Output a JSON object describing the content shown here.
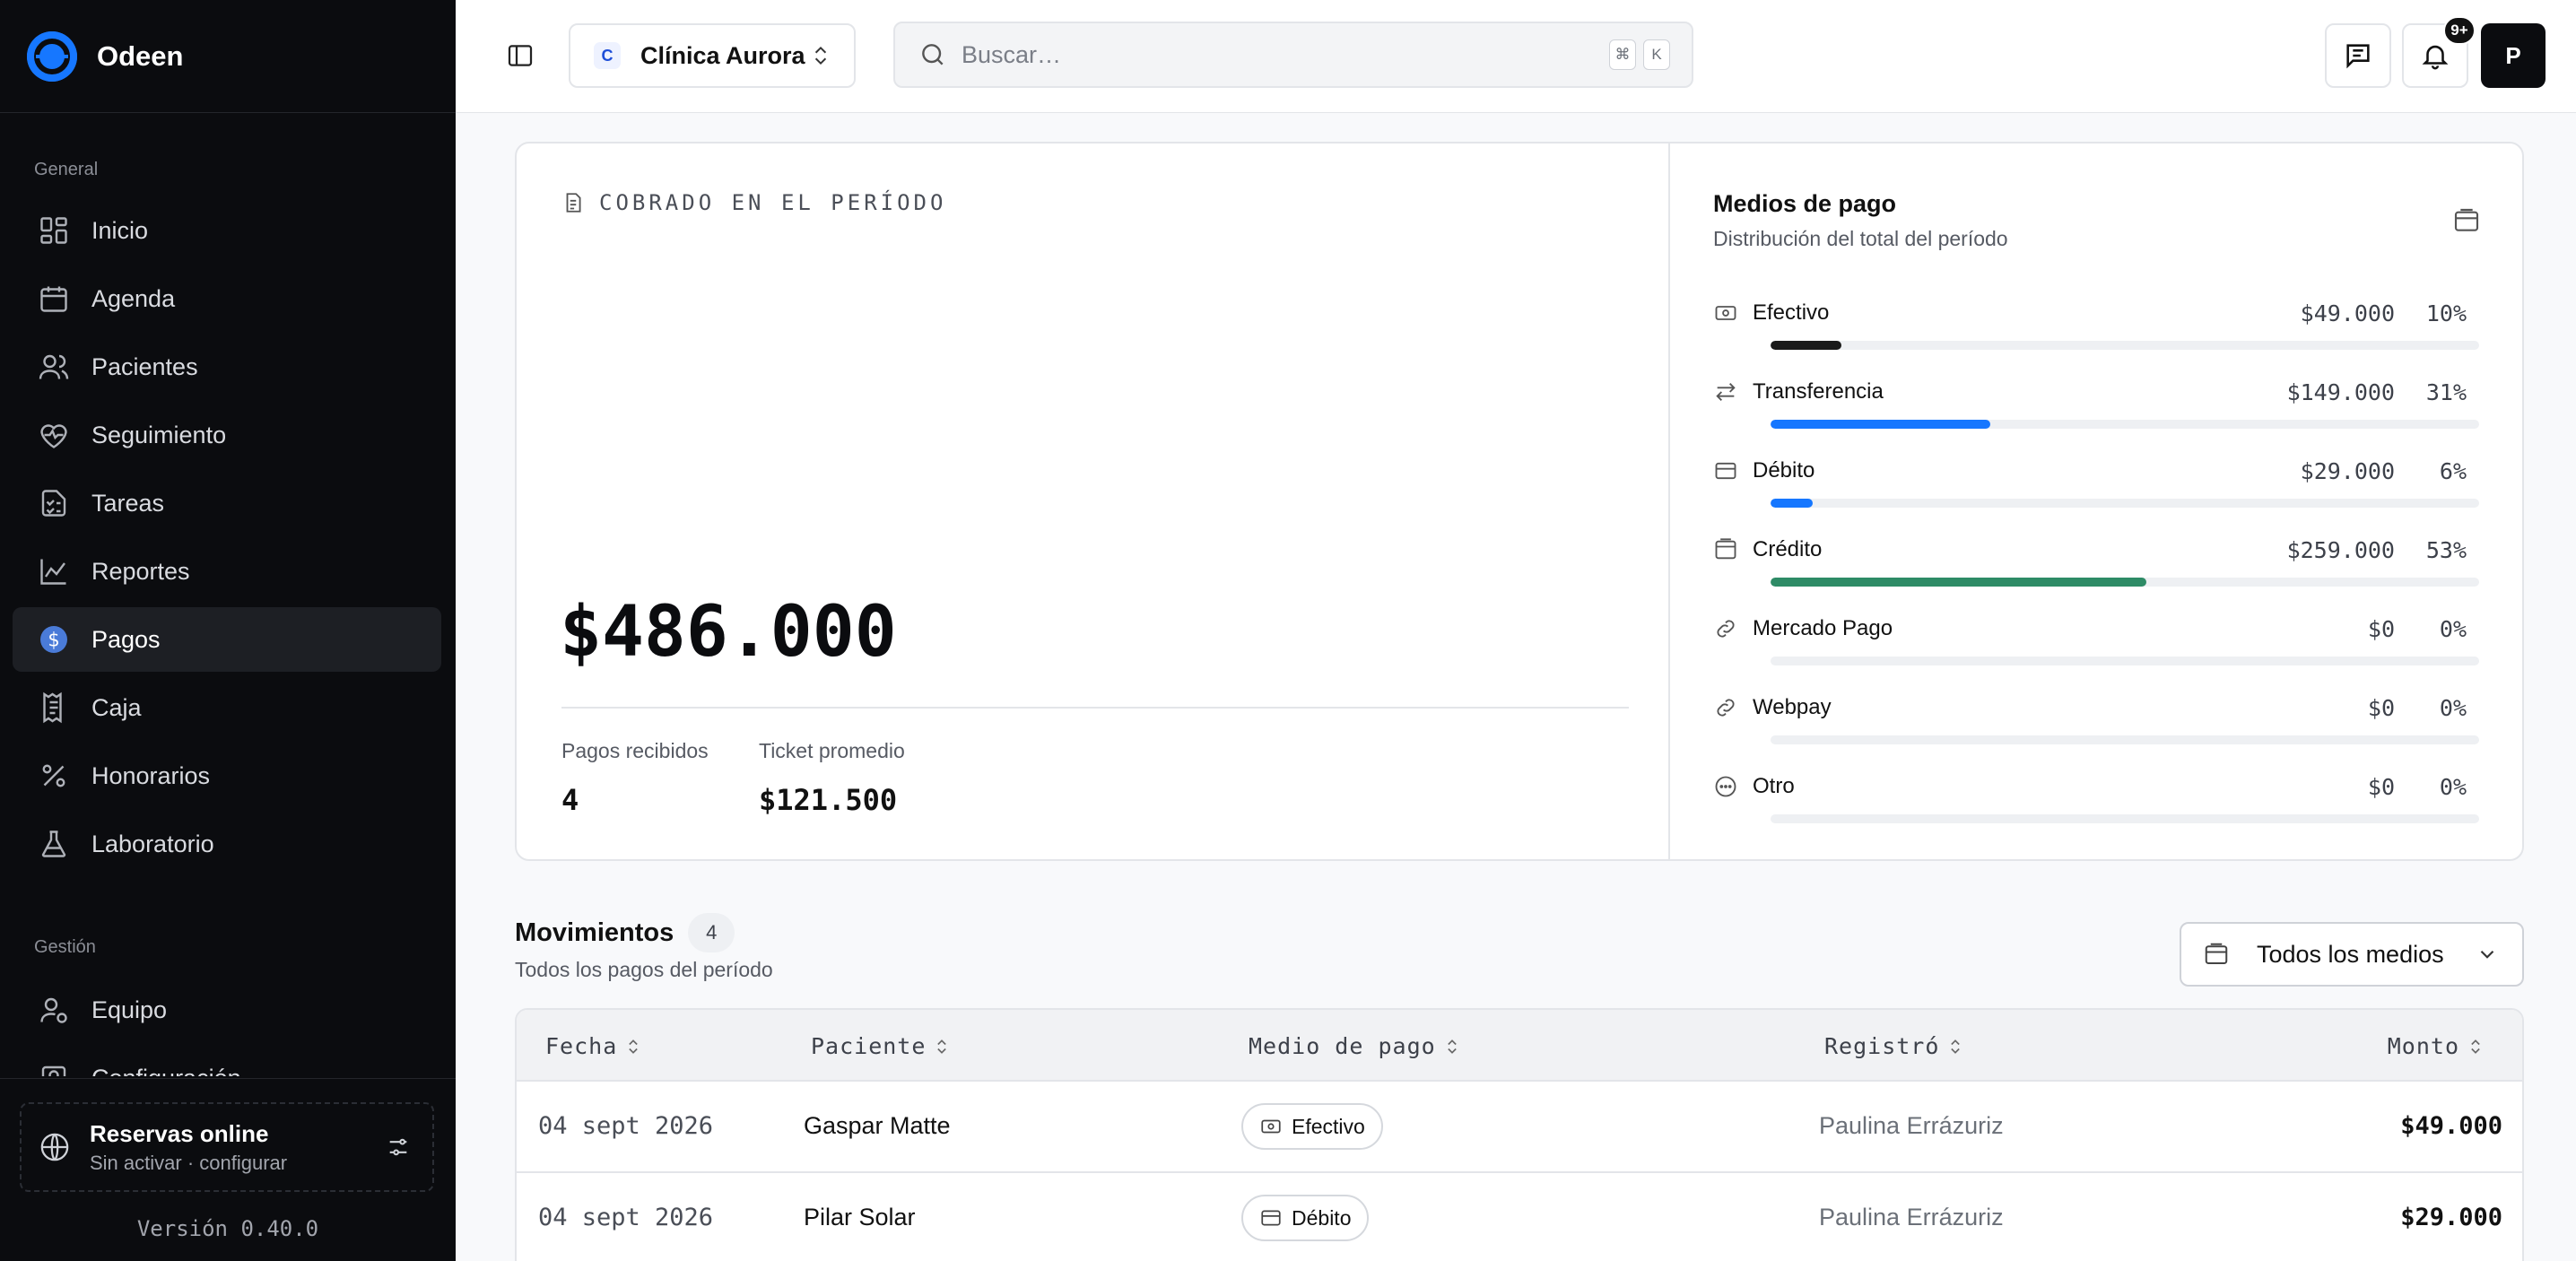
{
  "app": {
    "name": "Odeen",
    "version": "Versión 0.40.0"
  },
  "sidebar": {
    "section_general": "General",
    "section_gestion": "Gestión",
    "items": [
      {
        "label": "Inicio",
        "icon": "dashboard-icon"
      },
      {
        "label": "Agenda",
        "icon": "calendar-icon"
      },
      {
        "label": "Pacientes",
        "icon": "users-icon"
      },
      {
        "label": "Seguimiento",
        "icon": "heart-pulse-icon"
      },
      {
        "label": "Tareas",
        "icon": "checklist-icon"
      },
      {
        "label": "Reportes",
        "icon": "chart-line-icon"
      },
      {
        "label": "Pagos",
        "icon": "dollar-circle-icon",
        "active": true
      },
      {
        "label": "Caja",
        "icon": "receipt-icon"
      },
      {
        "label": "Honorarios",
        "icon": "percent-icon"
      },
      {
        "label": "Laboratorio",
        "icon": "flask-icon"
      }
    ],
    "gestion_items": [
      {
        "label": "Equipo",
        "icon": "user-cog-icon"
      },
      {
        "label": "Configuración",
        "icon": "settings-icon"
      }
    ],
    "reservas": {
      "title": "Reservas online",
      "subtitle": "Sin activar · configurar"
    }
  },
  "topbar": {
    "clinic_initial": "C",
    "clinic_name": "Clínica Aurora",
    "search_placeholder": "Buscar…",
    "shortcut_cmd": "⌘",
    "shortcut_key": "K",
    "notifications_badge": "9+",
    "avatar_initial": "P"
  },
  "summary": {
    "label": "COBRADO EN EL PERÍODO",
    "total": "$486.000",
    "pagos_label": "Pagos recibidos",
    "pagos_value": "4",
    "ticket_label": "Ticket promedio",
    "ticket_value": "$121.500"
  },
  "medios": {
    "title": "Medios de pago",
    "subtitle": "Distribución del total del período",
    "items": [
      {
        "name": "Efectivo",
        "amount": "$49.000",
        "pct": "10%",
        "share": 0.1,
        "color": "#1a1a1a",
        "icon": "cash-icon"
      },
      {
        "name": "Transferencia",
        "amount": "$149.000",
        "pct": "31%",
        "share": 0.31,
        "color": "#1677ff",
        "icon": "transfer-icon"
      },
      {
        "name": "Débito",
        "amount": "$29.000",
        "pct": "6%",
        "share": 0.06,
        "color": "#1677ff",
        "icon": "card-icon"
      },
      {
        "name": "Crédito",
        "amount": "$259.000",
        "pct": "53%",
        "share": 0.53,
        "color": "#2e8b66",
        "icon": "credit-card-icon"
      },
      {
        "name": "Mercado Pago",
        "amount": "$0",
        "pct": "0%",
        "share": 0,
        "color": "#1677ff",
        "icon": "link-icon"
      },
      {
        "name": "Webpay",
        "amount": "$0",
        "pct": "0%",
        "share": 0,
        "color": "#1677ff",
        "icon": "link-icon"
      },
      {
        "name": "Otro",
        "amount": "$0",
        "pct": "0%",
        "share": 0,
        "color": "#1677ff",
        "icon": "more-circle-icon"
      }
    ]
  },
  "movimientos": {
    "title": "Movimientos",
    "count": "4",
    "subtitle": "Todos los pagos del período",
    "filter_label": "Todos los medios",
    "columns": [
      "Fecha",
      "Paciente",
      "Medio de pago",
      "Registró",
      "Monto"
    ],
    "rows": [
      {
        "fecha": "04 sept 2026",
        "paciente": "Gaspar Matte",
        "medio": "Efectivo",
        "registro": "Paulina Errázuriz",
        "monto": "$49.000"
      },
      {
        "fecha": "04 sept 2026",
        "paciente": "Pilar Solar",
        "medio": "Débito",
        "registro": "Paulina Errázuriz",
        "monto": "$29.000"
      }
    ]
  }
}
